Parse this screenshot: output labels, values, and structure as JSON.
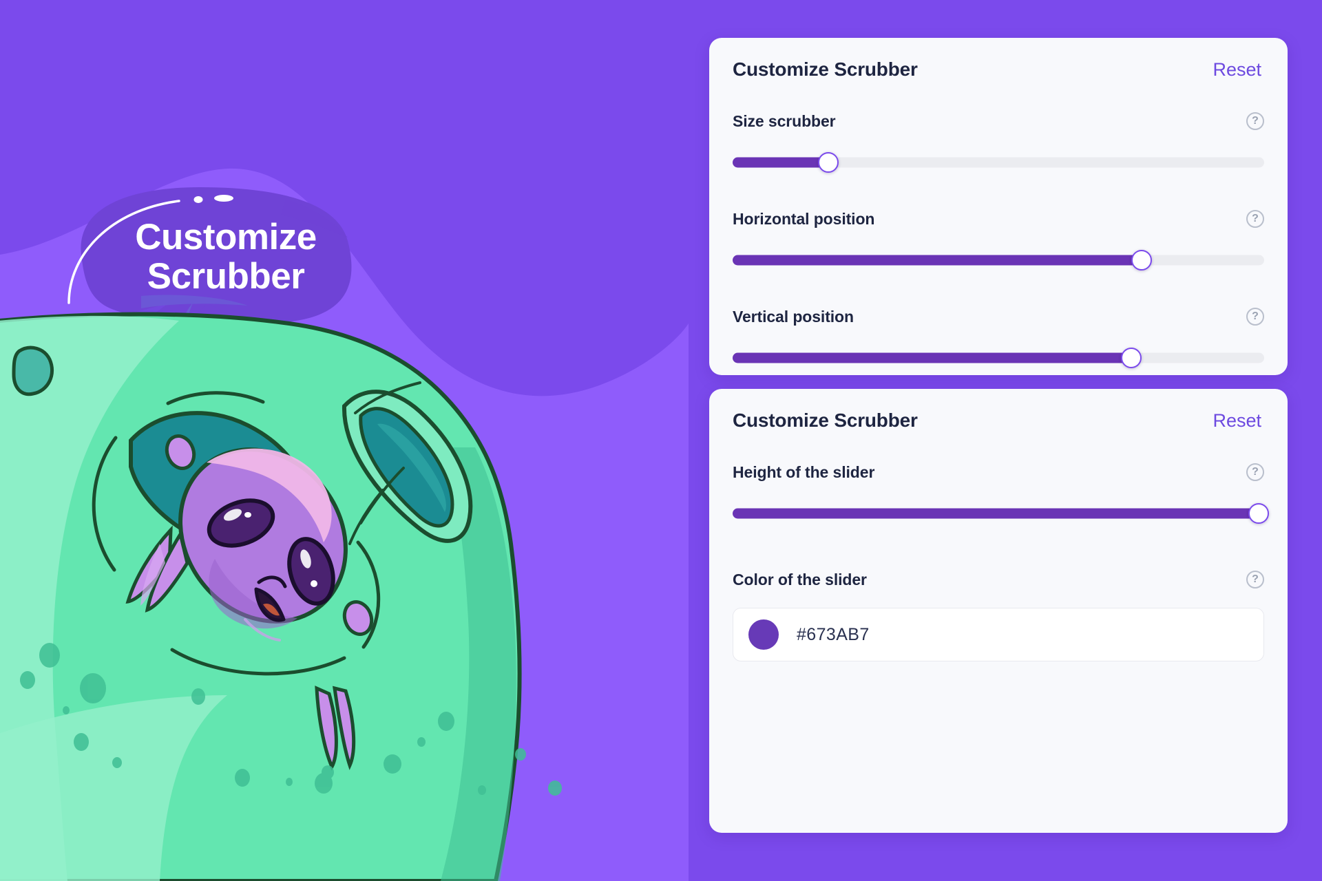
{
  "illustration": {
    "bubble_text_line1": "Customize",
    "bubble_text_line2": "Scrubber",
    "colors": {
      "bg_purple_dark": "#7B4AEC",
      "bg_purple_light": "#8F5CFB",
      "bubble_purple": "#6F43D6",
      "blob_green": "#63E6B0",
      "blob_green_light": "#93F0CB",
      "blob_teal": "#1B8C93",
      "outline_green": "#1B4D2E",
      "character_body": "#B07BE0",
      "character_head_light": "#F0B7E8",
      "character_eye": "#4A2270",
      "character_mouth": "#C0563A",
      "smoke_purple": "#6B5BD6"
    }
  },
  "panel": {
    "cards": [
      {
        "title": "Customize Scrubber",
        "reset_label": "Reset",
        "fields": [
          {
            "label": "Size scrubber",
            "help_icon": "question-circle-icon",
            "type": "slider",
            "value_percent": 18
          },
          {
            "label": "Horizontal position",
            "help_icon": "question-circle-icon",
            "type": "slider",
            "value_percent": 77
          },
          {
            "label": "Vertical position",
            "help_icon": "question-circle-icon",
            "type": "slider",
            "value_percent": 75
          }
        ]
      },
      {
        "title": "Customize Scrubber",
        "reset_label": "Reset",
        "fields": [
          {
            "label": "Height of the slider",
            "help_icon": "question-circle-icon",
            "type": "slider",
            "value_percent": 99
          },
          {
            "label": "Color of the slider",
            "help_icon": "question-circle-icon",
            "type": "color",
            "value": "#673AB7",
            "swatch_color": "#673AB7"
          }
        ]
      }
    ],
    "help_glyph": "?",
    "accent_color": "#6D4AE0",
    "slider_fill_color": "#6A34B5",
    "slider_track_color": "#EBECF0"
  }
}
